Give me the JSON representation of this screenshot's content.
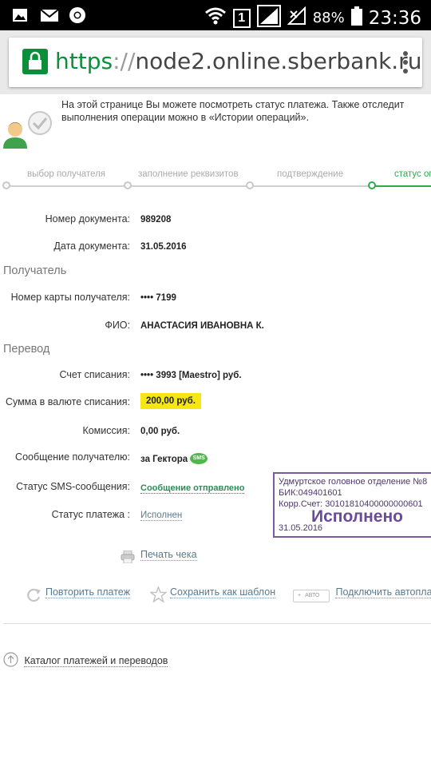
{
  "status_bar": {
    "battery_percent": "88%",
    "time": "23:36",
    "sim_label": "1"
  },
  "browser": {
    "url_scheme": "https",
    "url_sep": "://",
    "url_host": "node2.online.sberbank.ru"
  },
  "info": {
    "line1": "На этой странице Вы можете посмотреть статус платежа. Также отследит",
    "line2": "выполнения операции можно в «Истории операций»."
  },
  "steps": [
    {
      "label": "выбор получателя",
      "active": false
    },
    {
      "label": "заполнение реквизитов",
      "active": false
    },
    {
      "label": "подтверждение",
      "active": false
    },
    {
      "label": "статус оп",
      "active": true
    }
  ],
  "document": {
    "number_label": "Номер документа:",
    "number_value": "989208",
    "date_label": "Дата документа:",
    "date_value": "31.05.2016"
  },
  "recipient": {
    "section_title": "Получатель",
    "card_label": "Номер карты получателя:",
    "card_value": "•••• 7199",
    "name_label": "ФИО:",
    "name_value": "АНАСТАСИЯ ИВАНОВНА К."
  },
  "transfer": {
    "section_title": "Перевод",
    "account_label": "Счет списания:",
    "account_value": "•••• 3993  [Maestro]  руб.",
    "amount_label": "Сумма в валюте списания:",
    "amount_value": "200,00  руб.",
    "fee_label": "Комиссия:",
    "fee_value": "0,00 руб.",
    "message_label": "Сообщение получателю:",
    "message_value": "за Гектора",
    "sms_badge": "SMS",
    "sms_status_label": "Статус SMS-сообщения:",
    "sms_status_value": "Сообщение отправлено",
    "payment_status_label": "Статус платежа :",
    "payment_status_value": "Исполнен"
  },
  "stamp": {
    "line1": "Удмуртское головное отделение №8",
    "line2": "БИК:049401601",
    "line3": "Корр.Счет: 30101810400000000601",
    "big": "Исполнено",
    "date": "31.05.2016"
  },
  "actions": {
    "print": "Печать чека",
    "repeat": "Повторить платеж",
    "save_template": "Сохранить как шаблон",
    "auto_badge": "АВТО",
    "autopay": "Подключить автоплатеж"
  },
  "catalog": "Каталог платежей и переводов"
}
